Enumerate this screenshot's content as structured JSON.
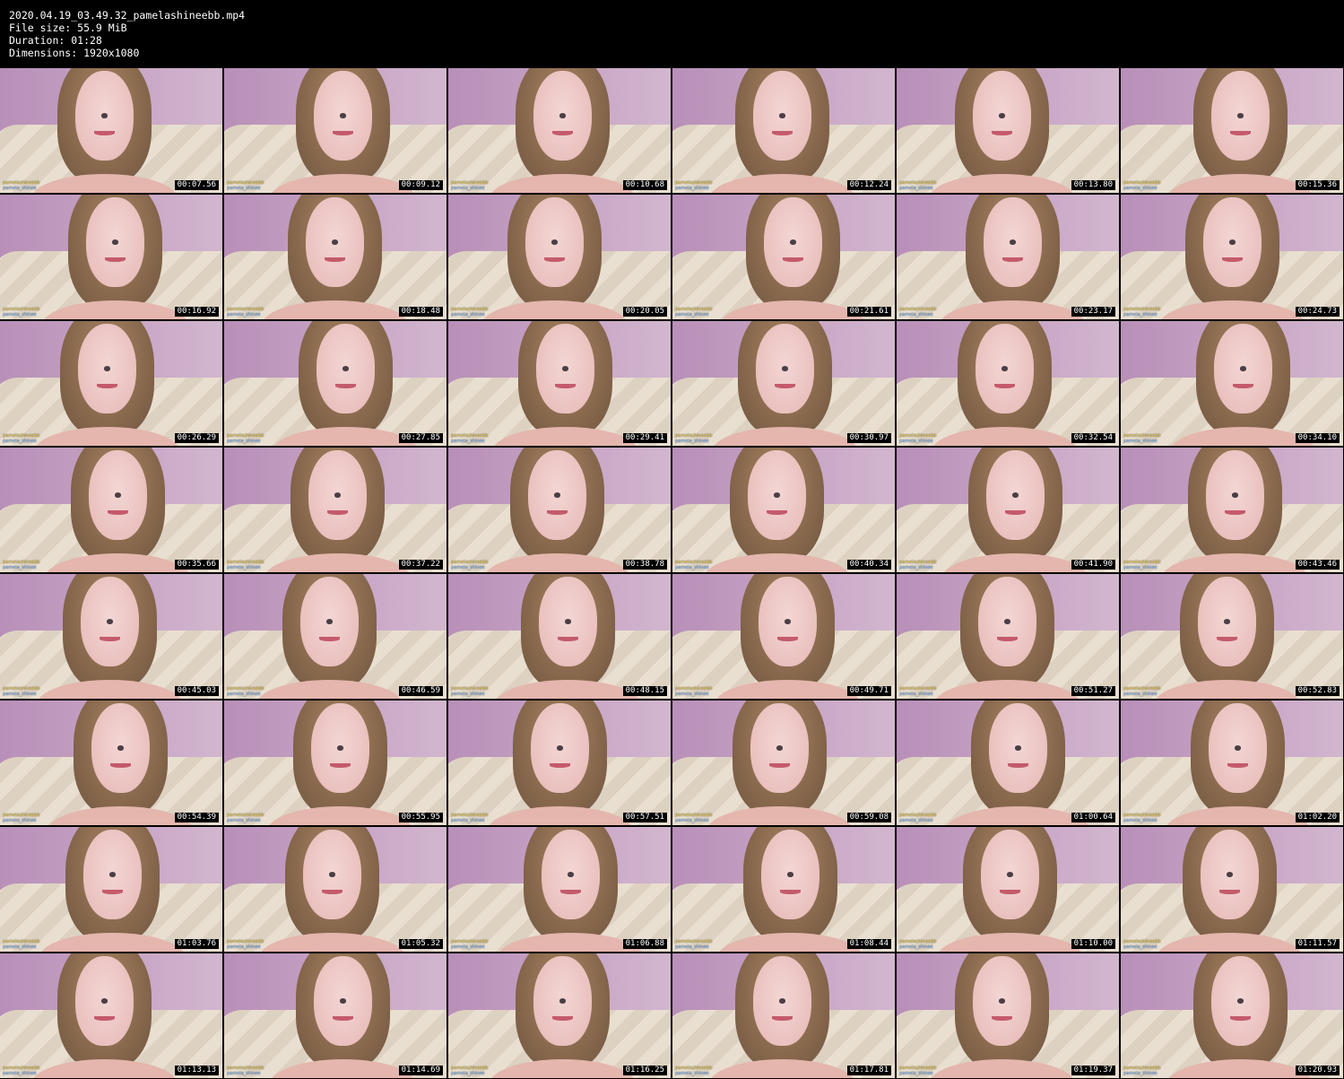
{
  "header": {
    "filename": "2020.04.19_03.49.32_pamelashineebb.mp4",
    "file_size": "File size: 55.9 MiB",
    "duration": "Duration: 01:28",
    "dimensions": "Dimensions: 1920x1080"
  },
  "watermark": {
    "line1": "pamelashineebb",
    "line2": "pamela_shinee"
  },
  "thumbnails": [
    "00:07.56",
    "00:09.12",
    "00:10.68",
    "00:12.24",
    "00:13.80",
    "00:15.36",
    "00:16.92",
    "00:18.48",
    "00:20.05",
    "00:21.61",
    "00:23.17",
    "00:24.73",
    "00:26.29",
    "00:27.85",
    "00:29.41",
    "00:30.97",
    "00:32.54",
    "00:34.10",
    "00:35.66",
    "00:37.22",
    "00:38.78",
    "00:40.34",
    "00:41.90",
    "00:43.46",
    "00:45.03",
    "00:46.59",
    "00:48.15",
    "00:49.71",
    "00:51.27",
    "00:52.83",
    "00:54.39",
    "00:55.95",
    "00:57.51",
    "00:59.08",
    "01:00.64",
    "01:02.20",
    "01:03.76",
    "01:05.32",
    "01:06.88",
    "01:08.44",
    "01:10.00",
    "01:11.57",
    "01:13.13",
    "01:14.69",
    "01:16.25",
    "01:17.81",
    "01:19.37",
    "01:20.93"
  ]
}
